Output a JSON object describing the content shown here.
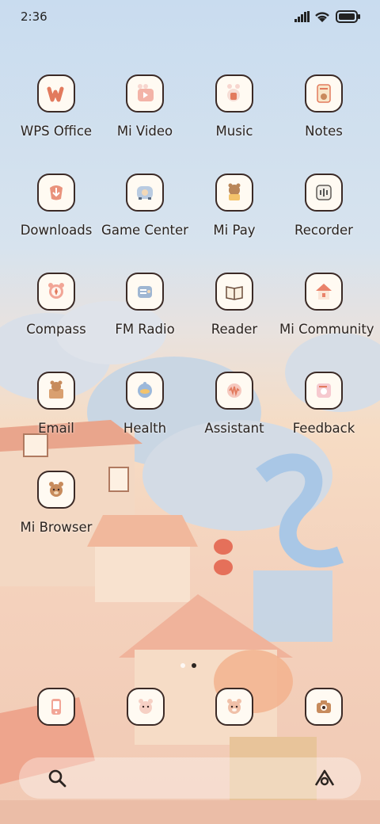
{
  "status_bar": {
    "time": "2:36"
  },
  "apps": [
    {
      "label": "WPS Office",
      "icon": "wps-icon"
    },
    {
      "label": "Mi Video",
      "icon": "video-icon"
    },
    {
      "label": "Music",
      "icon": "music-icon"
    },
    {
      "label": "Notes",
      "icon": "notes-icon"
    },
    {
      "label": "Downloads",
      "icon": "download-icon"
    },
    {
      "label": "Game Center",
      "icon": "game-icon"
    },
    {
      "label": "Mi Pay",
      "icon": "pay-icon"
    },
    {
      "label": "Recorder",
      "icon": "recorder-icon"
    },
    {
      "label": "Compass",
      "icon": "compass-icon"
    },
    {
      "label": "FM Radio",
      "icon": "radio-icon"
    },
    {
      "label": "Reader",
      "icon": "book-icon"
    },
    {
      "label": "Mi Community",
      "icon": "house-icon"
    },
    {
      "label": "Email",
      "icon": "email-icon"
    },
    {
      "label": "Health",
      "icon": "health-icon"
    },
    {
      "label": "Assistant",
      "icon": "assistant-icon"
    },
    {
      "label": "Feedback",
      "icon": "feedback-icon"
    },
    {
      "label": "Mi Browser",
      "icon": "browser-icon"
    }
  ],
  "dock": [
    {
      "icon": "phone-icon"
    },
    {
      "icon": "messages-icon"
    },
    {
      "icon": "contacts-icon"
    },
    {
      "icon": "camera-icon"
    }
  ],
  "page_indicator": {
    "total": 2,
    "active": 2
  },
  "colors": {
    "icon_outline": "#3b2a26",
    "icon_fill": "#fffaf2",
    "accent": "#e27a5d",
    "label": "#2b2420"
  }
}
